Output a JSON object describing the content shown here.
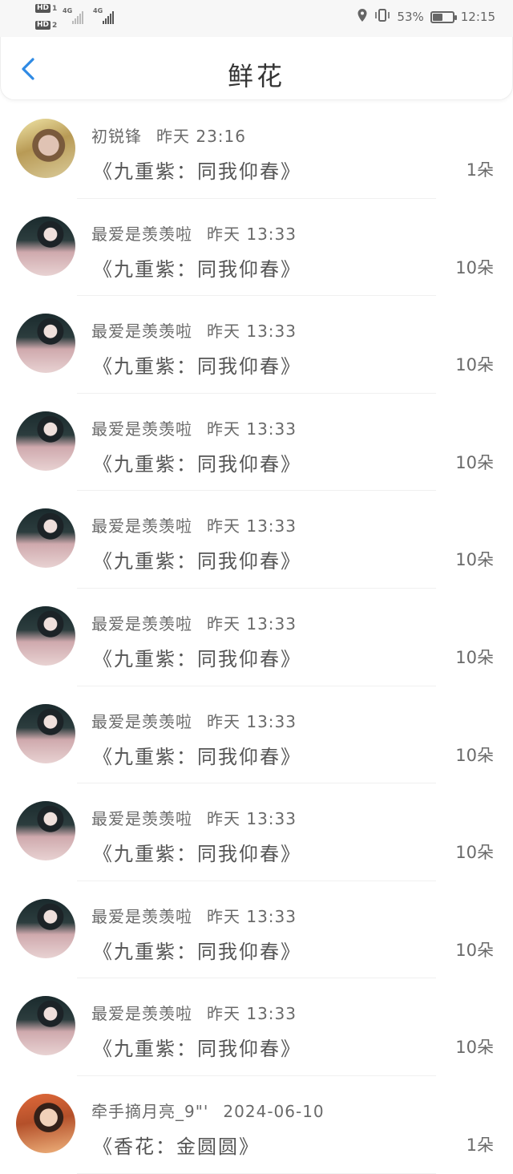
{
  "status_bar": {
    "sim1_label": "HD",
    "sim1_slot": "1",
    "sim2_label": "HD",
    "sim2_slot": "2",
    "network1": "4G",
    "network2": "4G",
    "battery_percent": "53%",
    "battery_level": 0.53,
    "time": "12:15",
    "icons": [
      "location-icon",
      "vibrate-icon",
      "battery-saver-icon"
    ]
  },
  "header": {
    "title": "鲜花",
    "back_icon": "chevron-left-icon",
    "accent": "#2f8ae4"
  },
  "items": [
    {
      "user": "初锐锋",
      "time": "昨天 23:16",
      "work": "《九重紫：同我仰春》",
      "count": "1朵",
      "avatar": "avatar-blonde"
    },
    {
      "user": "最爱是羡羡啦",
      "time": "昨天 13:33",
      "work": "《九重紫：同我仰春》",
      "count": "10朵",
      "avatar": "avatar-hanfu"
    },
    {
      "user": "最爱是羡羡啦",
      "time": "昨天 13:33",
      "work": "《九重紫：同我仰春》",
      "count": "10朵",
      "avatar": "avatar-hanfu"
    },
    {
      "user": "最爱是羡羡啦",
      "time": "昨天 13:33",
      "work": "《九重紫：同我仰春》",
      "count": "10朵",
      "avatar": "avatar-hanfu"
    },
    {
      "user": "最爱是羡羡啦",
      "time": "昨天 13:33",
      "work": "《九重紫：同我仰春》",
      "count": "10朵",
      "avatar": "avatar-hanfu"
    },
    {
      "user": "最爱是羡羡啦",
      "time": "昨天 13:33",
      "work": "《九重紫：同我仰春》",
      "count": "10朵",
      "avatar": "avatar-hanfu"
    },
    {
      "user": "最爱是羡羡啦",
      "time": "昨天 13:33",
      "work": "《九重紫：同我仰春》",
      "count": "10朵",
      "avatar": "avatar-hanfu"
    },
    {
      "user": "最爱是羡羡啦",
      "time": "昨天 13:33",
      "work": "《九重紫：同我仰春》",
      "count": "10朵",
      "avatar": "avatar-hanfu"
    },
    {
      "user": "最爱是羡羡啦",
      "time": "昨天 13:33",
      "work": "《九重紫：同我仰春》",
      "count": "10朵",
      "avatar": "avatar-hanfu"
    },
    {
      "user": "最爱是羡羡啦",
      "time": "昨天 13:33",
      "work": "《九重紫：同我仰春》",
      "count": "10朵",
      "avatar": "avatar-hanfu"
    },
    {
      "user": "牵手摘月亮_9\"'",
      "time": "2024-06-10",
      "work": "《香花：金圆圆》",
      "count": "1朵",
      "avatar": "avatar-autumn"
    }
  ]
}
